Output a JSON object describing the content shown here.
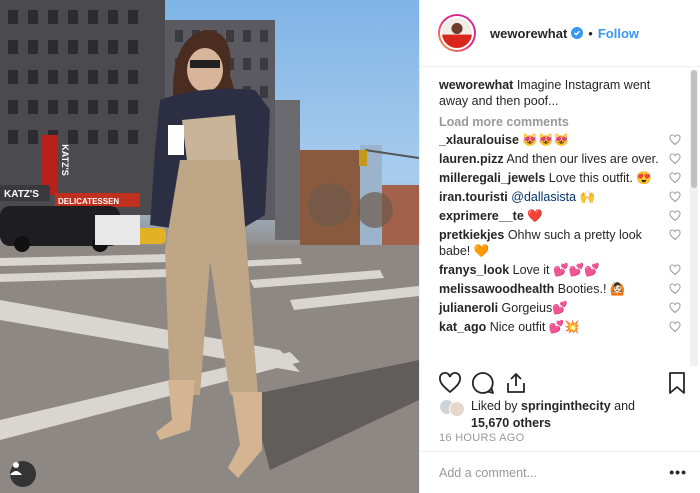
{
  "post": {
    "header": {
      "username": "weworewhat",
      "verified_icon": "verified-badge-icon",
      "separator": "•",
      "follow_label": "Follow"
    },
    "caption": {
      "username": "weworewhat",
      "text": "Imagine Instagram went away and then poof..."
    },
    "load_more_label": "Load more comments",
    "comments": [
      {
        "username": "_xlauralouise",
        "text": "😻😻😻"
      },
      {
        "username": "lauren.pizz",
        "text": "And then our lives are over."
      },
      {
        "username": "milleregali_jewels",
        "text": "Love this outfit. 😍"
      },
      {
        "username": "iran.touristi",
        "mention": "@dallasista",
        "text": "🙌"
      },
      {
        "username": "exprimere__te",
        "text": "❤️"
      },
      {
        "username": "pretkiekjes",
        "text": "Ohhw such a pretty look babe! 🧡"
      },
      {
        "username": "franys_look",
        "text": "Love it 💕💕💕"
      },
      {
        "username": "melissawoodhealth",
        "text": "Booties.! 🙆🏻"
      },
      {
        "username": "julianeroli",
        "text": "Gorgeius💕"
      },
      {
        "username": "kat_ago",
        "text": "Nice outfit 💕💥"
      }
    ],
    "actions": {
      "like_icon": "heart-outline-icon",
      "comment_icon": "comment-bubble-icon",
      "share_icon": "share-upload-icon",
      "save_icon": "bookmark-outline-icon"
    },
    "likes": {
      "prefix": "Liked by",
      "username": "springinthecity",
      "middle": "and",
      "others": "15,670 others"
    },
    "timestamp": "16 HOURS AGO",
    "add_comment": {
      "placeholder": "Add a comment...",
      "more_label": "•••"
    },
    "photo": {
      "user_tag_icon": "user-tag-icon",
      "signs": {
        "katzs_vertical": "KATZ'S",
        "katzs_horizontal": "KATZ'S",
        "deli": "DELICATESSEN"
      }
    },
    "colors": {
      "accent_blue": "#3897f0",
      "text_dark": "#262626",
      "muted_gray": "#999999",
      "verified_blue": "#3897f0"
    }
  }
}
